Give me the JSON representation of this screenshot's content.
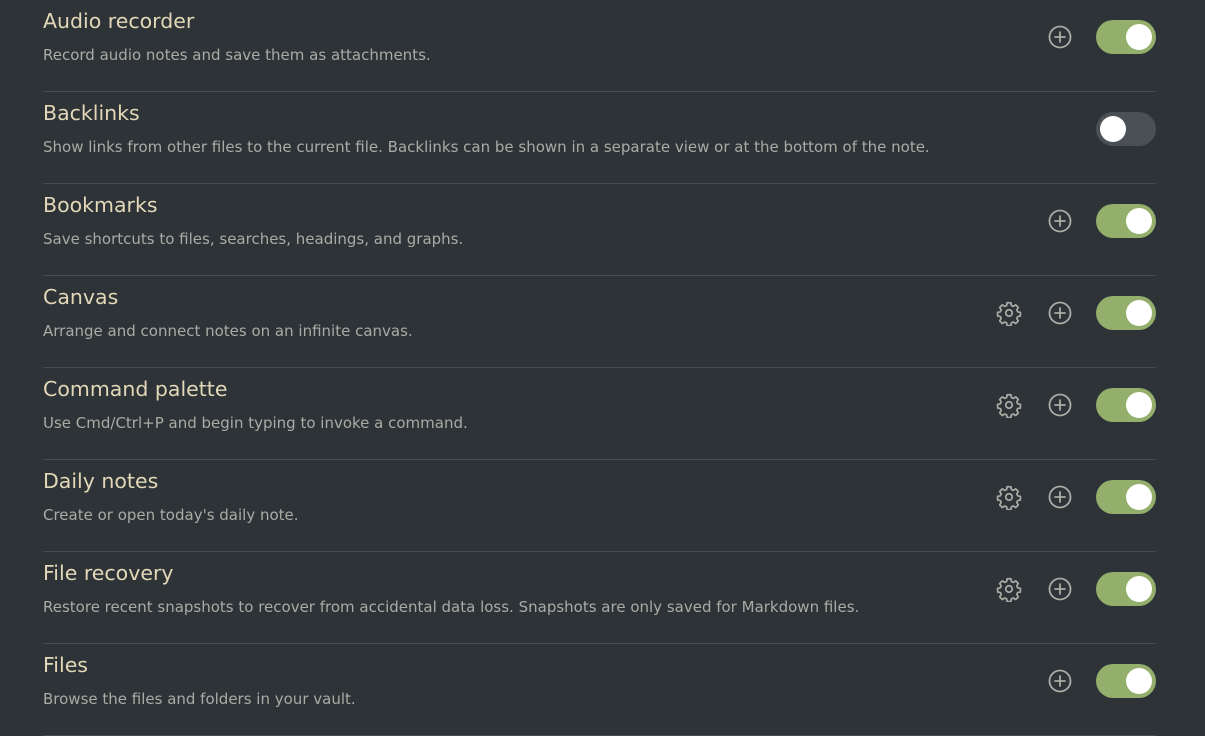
{
  "plugins": [
    {
      "name": "Audio recorder",
      "description": "Record audio notes and save them as attachments.",
      "has_settings": false,
      "has_hotkey": true,
      "enabled": true
    },
    {
      "name": "Backlinks",
      "description": "Show links from other files to the current file. Backlinks can be shown in a separate view or at the bottom of the note.",
      "has_settings": false,
      "has_hotkey": false,
      "enabled": false
    },
    {
      "name": "Bookmarks",
      "description": "Save shortcuts to files, searches, headings, and graphs.",
      "has_settings": false,
      "has_hotkey": true,
      "enabled": true
    },
    {
      "name": "Canvas",
      "description": "Arrange and connect notes on an infinite canvas.",
      "has_settings": true,
      "has_hotkey": true,
      "enabled": true
    },
    {
      "name": "Command palette",
      "description": "Use Cmd/Ctrl+P and begin typing to invoke a command.",
      "has_settings": true,
      "has_hotkey": true,
      "enabled": true
    },
    {
      "name": "Daily notes",
      "description": "Create or open today's daily note.",
      "has_settings": true,
      "has_hotkey": true,
      "enabled": true
    },
    {
      "name": "File recovery",
      "description": "Restore recent snapshots to recover from accidental data loss. Snapshots are only saved for Markdown files.",
      "has_settings": true,
      "has_hotkey": true,
      "enabled": true
    },
    {
      "name": "Files",
      "description": "Browse the files and folders in your vault.",
      "has_settings": false,
      "has_hotkey": true,
      "enabled": true
    }
  ],
  "icons": {
    "settings": "gear-icon",
    "hotkey": "plus-circle-icon"
  },
  "colors": {
    "background": "#2e3338",
    "title_text": "#e2d8b8",
    "description_text": "#a9aca4",
    "toggle_on": "#94ae6c",
    "toggle_off": "#4b5057",
    "divider": "#454a50"
  }
}
